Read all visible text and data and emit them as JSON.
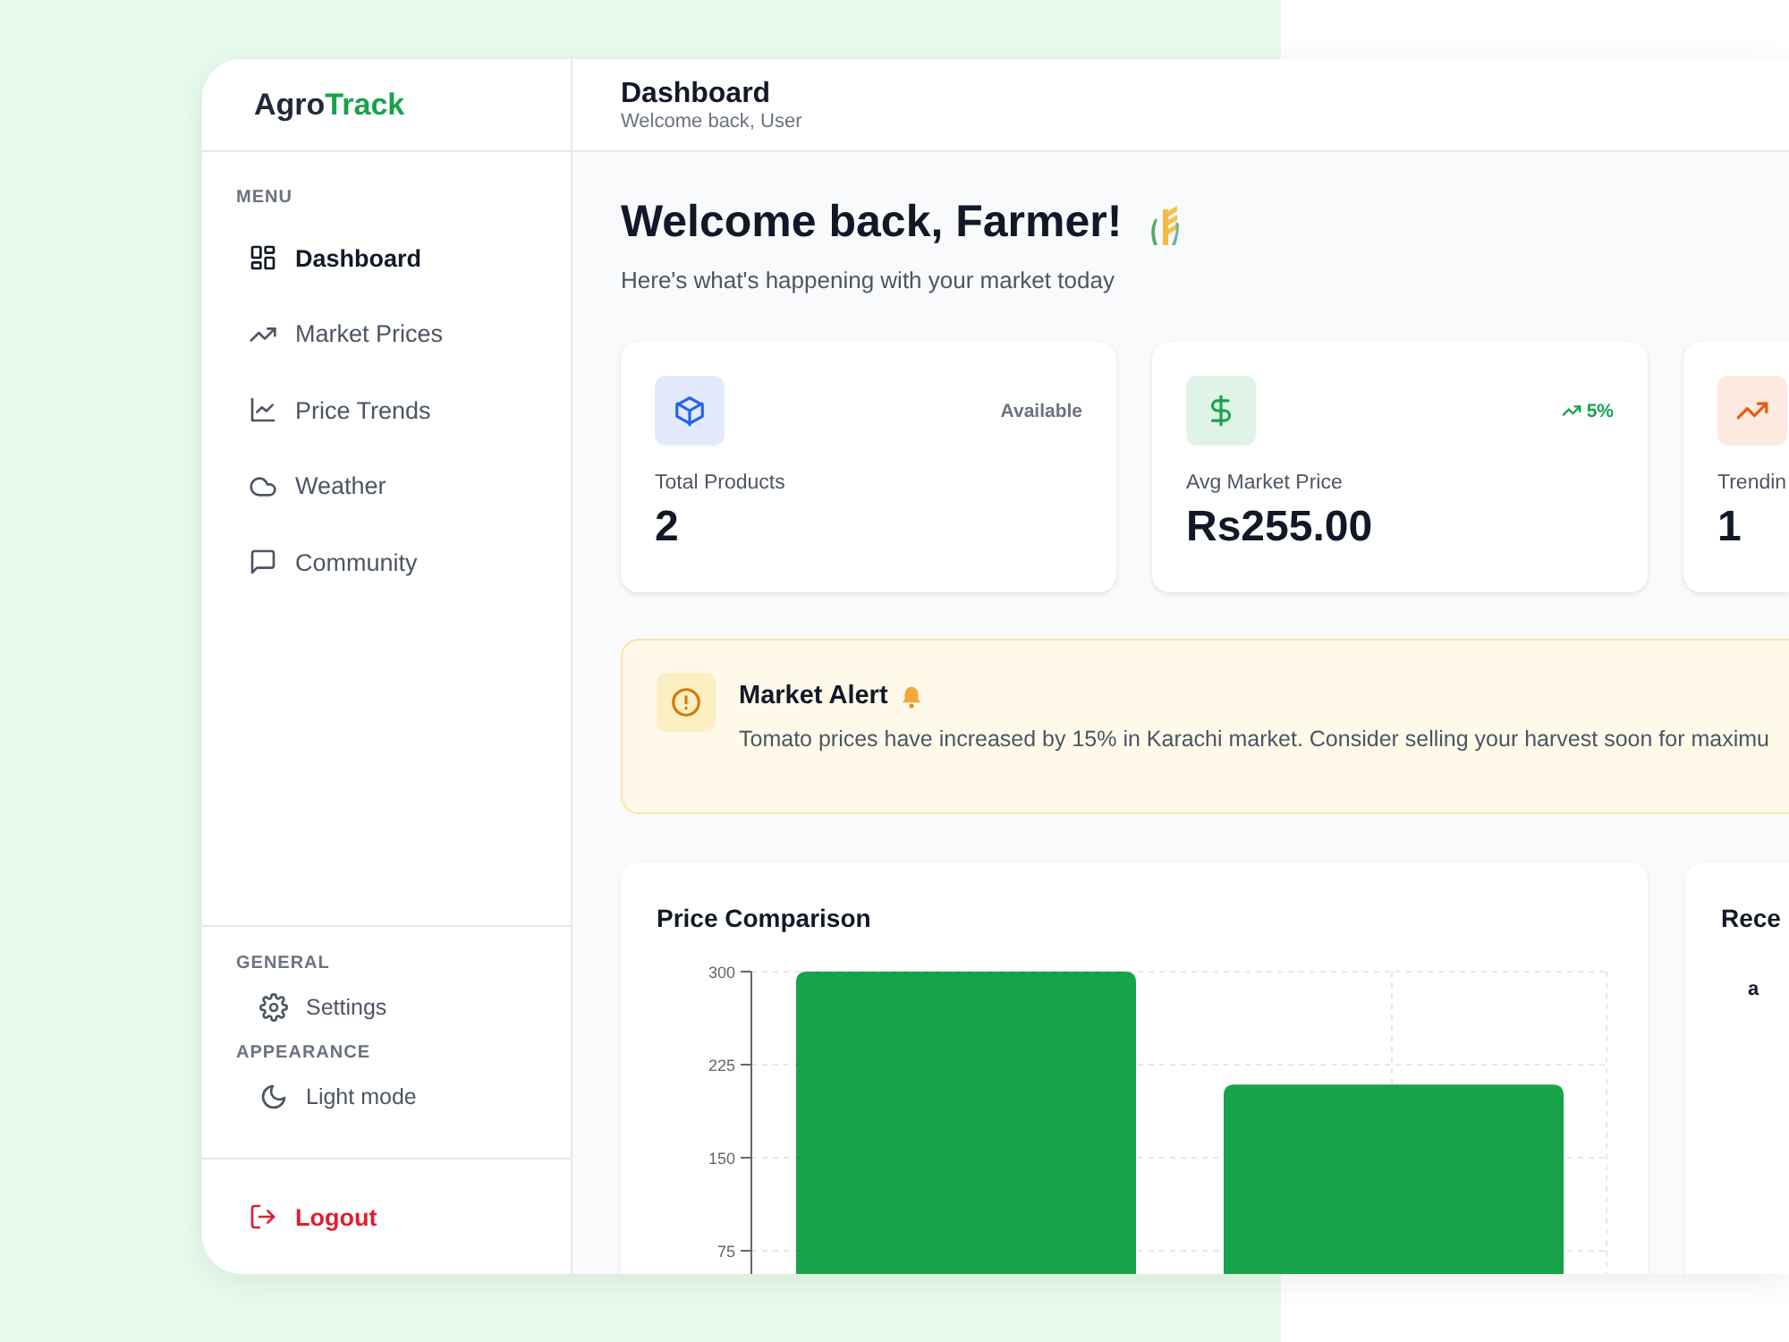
{
  "brand": {
    "prefix": "Agro",
    "accent": "Track"
  },
  "header": {
    "title": "Dashboard",
    "subtitle": "Welcome back, User"
  },
  "sidebar": {
    "menu_label": "MENU",
    "items": [
      {
        "label": "Dashboard",
        "selected": true
      },
      {
        "label": "Market Prices",
        "selected": false
      },
      {
        "label": "Price Trends",
        "selected": false
      },
      {
        "label": "Weather",
        "selected": false
      },
      {
        "label": "Community",
        "selected": false
      }
    ],
    "sections": [
      {
        "label": "GENERAL",
        "items": [
          {
            "label": "Settings"
          }
        ]
      },
      {
        "label": "APPEARANCE",
        "items": [
          {
            "label": "Light mode"
          }
        ]
      }
    ],
    "logout": "Logout"
  },
  "welcome": {
    "title": "Welcome back, Farmer!",
    "subtitle": "Here's what's happening with your market today"
  },
  "stats": [
    {
      "label": "Total Products",
      "value": "2",
      "badge": "Available",
      "kind": "status",
      "color": "#2563eb"
    },
    {
      "label": "Avg Market Price",
      "value": "Rs255.00",
      "badge": "5%",
      "kind": "trend",
      "color": "#16a34a"
    },
    {
      "label": "Trendin",
      "value": "1",
      "kind": "none",
      "color": "#ea580c"
    }
  ],
  "alert": {
    "title": "Market Alert",
    "text": "Tomato prices have increased by 15% in Karachi market. Consider selling your harvest soon for maximu"
  },
  "price_comparison": {
    "title": "Price Comparison",
    "chart_data": {
      "type": "bar",
      "series": [
        {
          "color": "#16a34a",
          "values": [
            300,
            209
          ]
        }
      ],
      "grid": true,
      "ylim": [
        0,
        300
      ],
      "yticks": [
        75,
        150,
        225,
        300
      ]
    }
  },
  "recent": {
    "title": "Rece",
    "items": [
      "a"
    ]
  }
}
